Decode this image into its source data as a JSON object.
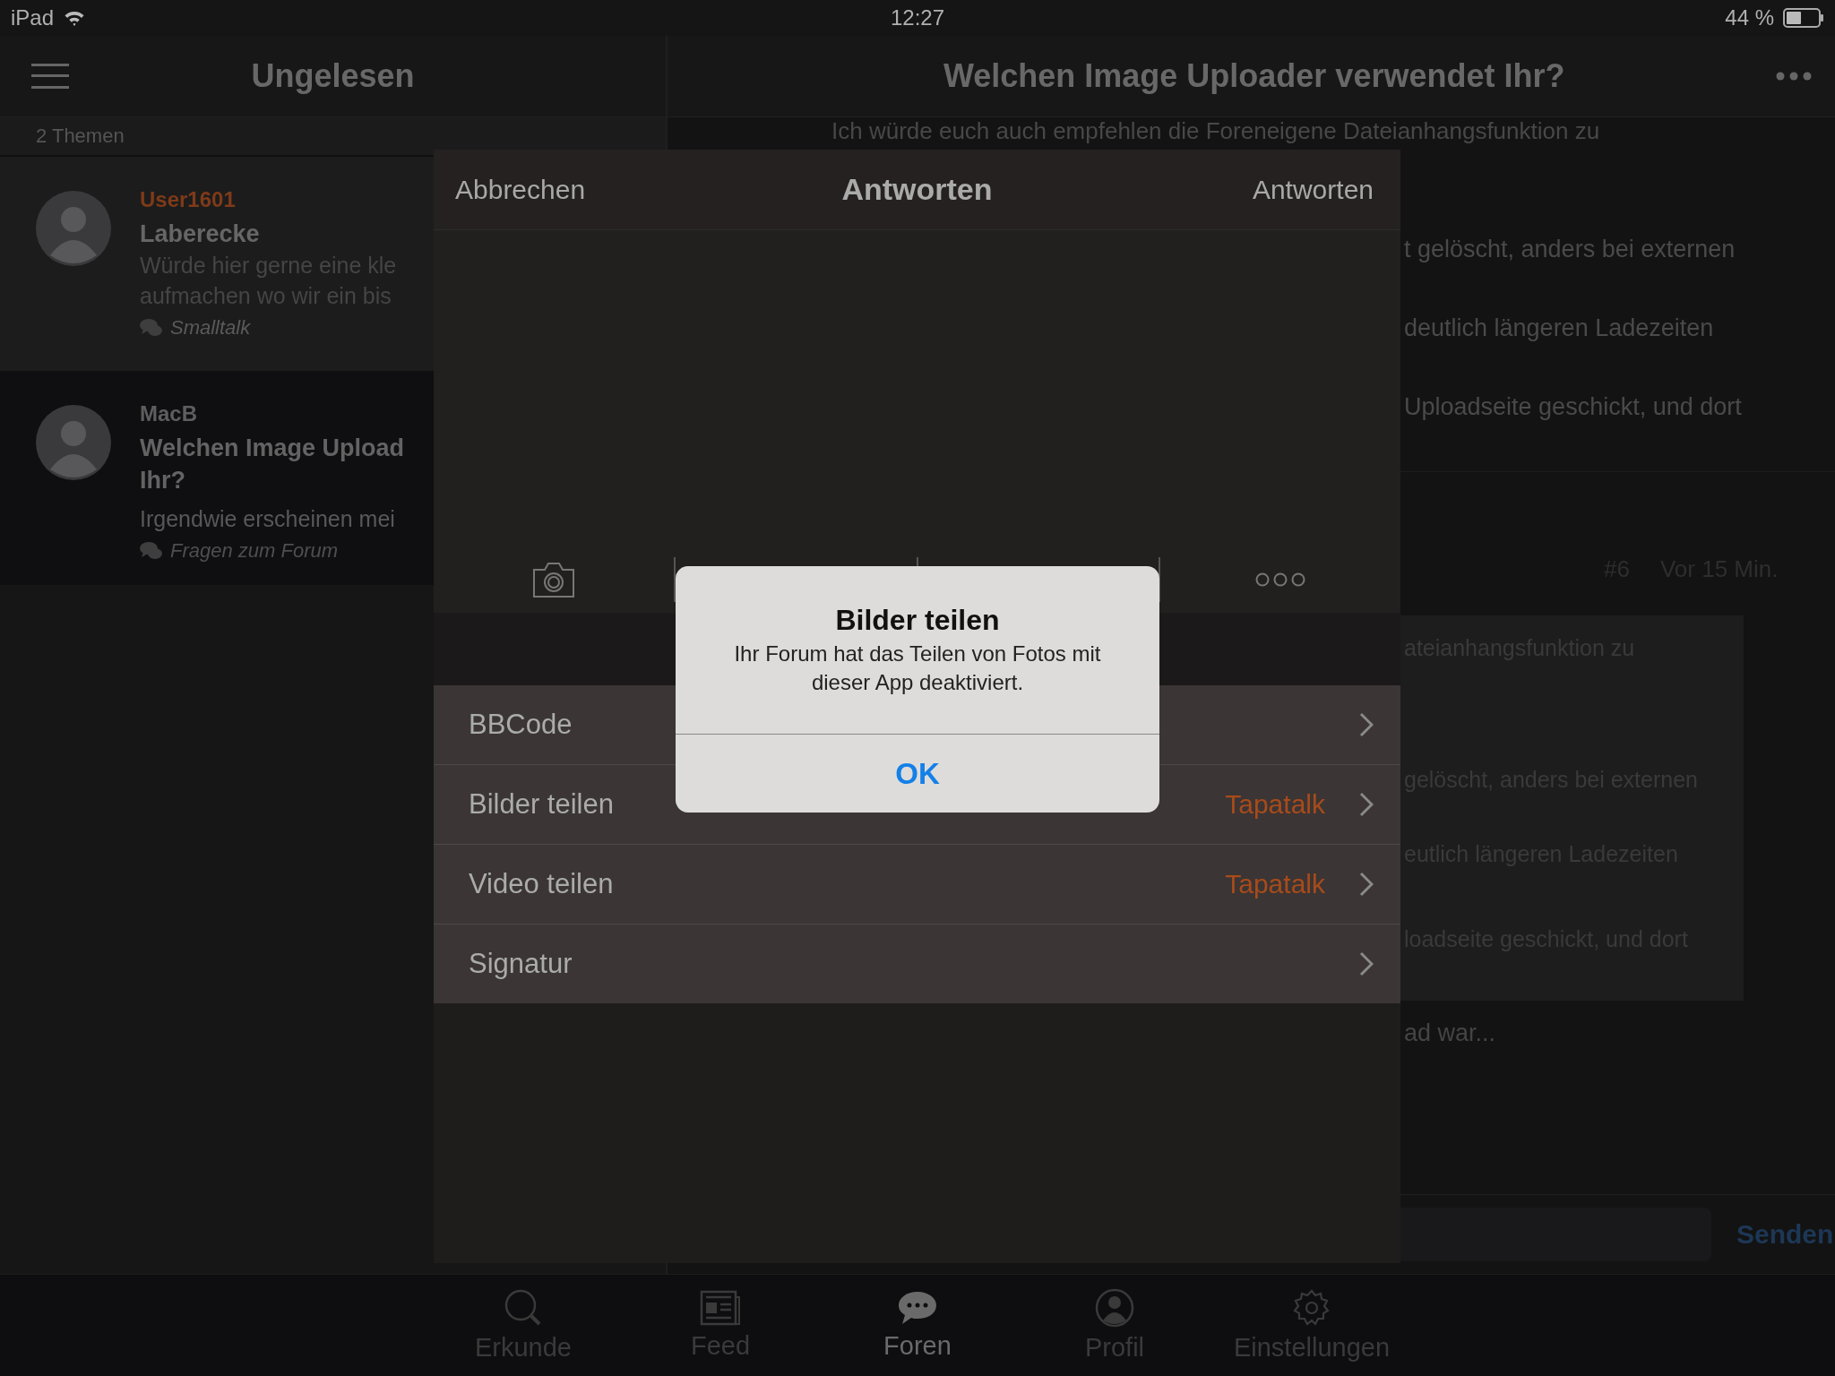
{
  "status_bar": {
    "carrier": "iPad",
    "time": "12:27",
    "battery": "44 %"
  },
  "sidebar": {
    "title": "Ungelesen",
    "count": "2 Themen",
    "topics": [
      {
        "author": "User1601",
        "color": "#7e3a19",
        "title": [
          "Laberecke"
        ],
        "preview": [
          "Würde hier gerne eine kle",
          "aufmachen wo wir ein bis"
        ],
        "forum": "Smalltalk",
        "selected": false
      },
      {
        "author": "MacB",
        "color": "#5e5e5e",
        "title": [
          "Welchen Image Upload",
          "Ihr?"
        ],
        "preview": [
          "Irgendwie erscheinen mei"
        ],
        "forum": "Fragen zum Forum",
        "selected": true
      }
    ]
  },
  "thread": {
    "title": "Welchen Image Uploader verwendet Ihr?",
    "intro": "Ich würde euch auch empfehlen die Foreneigene Dateianhangsfunktion zu",
    "fragments": [
      "t gelöscht, anders bei externen",
      "deutlich längeren Ladezeiten",
      "Uploadseite geschickt, und dort"
    ],
    "post_number": "#6",
    "post_time": "Vor 15 Min.",
    "quote": [
      "ateianhangsfunktion zu",
      "gelöscht, anders bei externen",
      "eutlich längeren Ladezeiten",
      "loadseite geschickt, und dort"
    ],
    "after": "ad war...",
    "send": "Senden"
  },
  "reply_sheet": {
    "cancel": "Abbrechen",
    "title": "Antworten",
    "submit": "Antworten",
    "options": [
      {
        "label": "BBCode"
      },
      {
        "label": "Bilder teilen",
        "value": "Tapatalk"
      },
      {
        "label": "Video teilen",
        "value": "Tapatalk"
      },
      {
        "label": "Signatur"
      }
    ]
  },
  "alert": {
    "title": "Bilder teilen",
    "message": "Ihr Forum hat das Teilen von Fotos mit dieser App deaktiviert.",
    "button": "OK"
  },
  "tabs": [
    {
      "label": "Erkunde",
      "kind": "search",
      "selected": false
    },
    {
      "label": "Feed",
      "kind": "feed",
      "selected": false
    },
    {
      "label": "Foren",
      "kind": "chat",
      "selected": true
    },
    {
      "label": "Profil",
      "kind": "profile",
      "selected": false
    },
    {
      "label": "Einstellungen",
      "kind": "settings",
      "selected": false
    }
  ]
}
